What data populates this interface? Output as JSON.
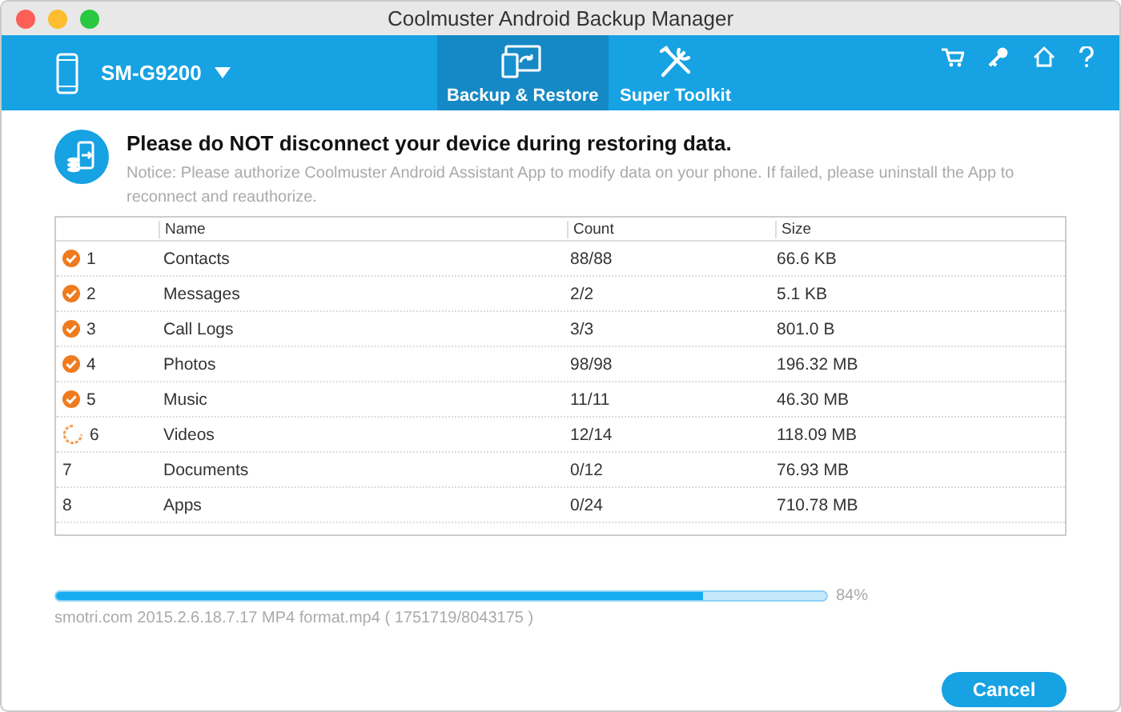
{
  "window": {
    "title": "Coolmuster Android Backup Manager"
  },
  "device": {
    "name": "SM-G9200"
  },
  "tabs": [
    {
      "label": "Backup & Restore",
      "selected": true
    },
    {
      "label": "Super Toolkit",
      "selected": false
    }
  ],
  "notice": {
    "heading": "Please do NOT disconnect your device during restoring data.",
    "text": "Notice: Please authorize Coolmuster Android Assistant App to modify data on your phone. If failed, please uninstall the App to reconnect and reauthorize."
  },
  "table": {
    "columns": [
      "Name",
      "Count",
      "Size"
    ],
    "rows": [
      {
        "kind": "done",
        "index": "1",
        "name": "Contacts",
        "count": "88/88",
        "size": "66.6 KB"
      },
      {
        "kind": "done",
        "index": "2",
        "name": "Messages",
        "count": "2/2",
        "size": "5.1 KB"
      },
      {
        "kind": "done",
        "index": "3",
        "name": "Call Logs",
        "count": "3/3",
        "size": "801.0 B"
      },
      {
        "kind": "done",
        "index": "4",
        "name": "Photos",
        "count": "98/98",
        "size": "196.32 MB"
      },
      {
        "kind": "done",
        "index": "5",
        "name": "Music",
        "count": "11/11",
        "size": "46.30 MB"
      },
      {
        "kind": "loading",
        "index": "6",
        "name": "Videos",
        "count": "12/14",
        "size": "118.09 MB"
      },
      {
        "kind": "none",
        "index": "7",
        "name": "Documents",
        "count": "0/12",
        "size": "76.93 MB"
      },
      {
        "kind": "none",
        "index": "8",
        "name": "Apps",
        "count": "0/24",
        "size": "710.78 MB"
      }
    ]
  },
  "progress": {
    "level": 0.84,
    "percent": "84%",
    "file": "smotri.com 2015.2.6.18.7.17 MP4 format.mp4 ( 1751719/8043175 )"
  },
  "buttons": [
    "Cancel"
  ]
}
